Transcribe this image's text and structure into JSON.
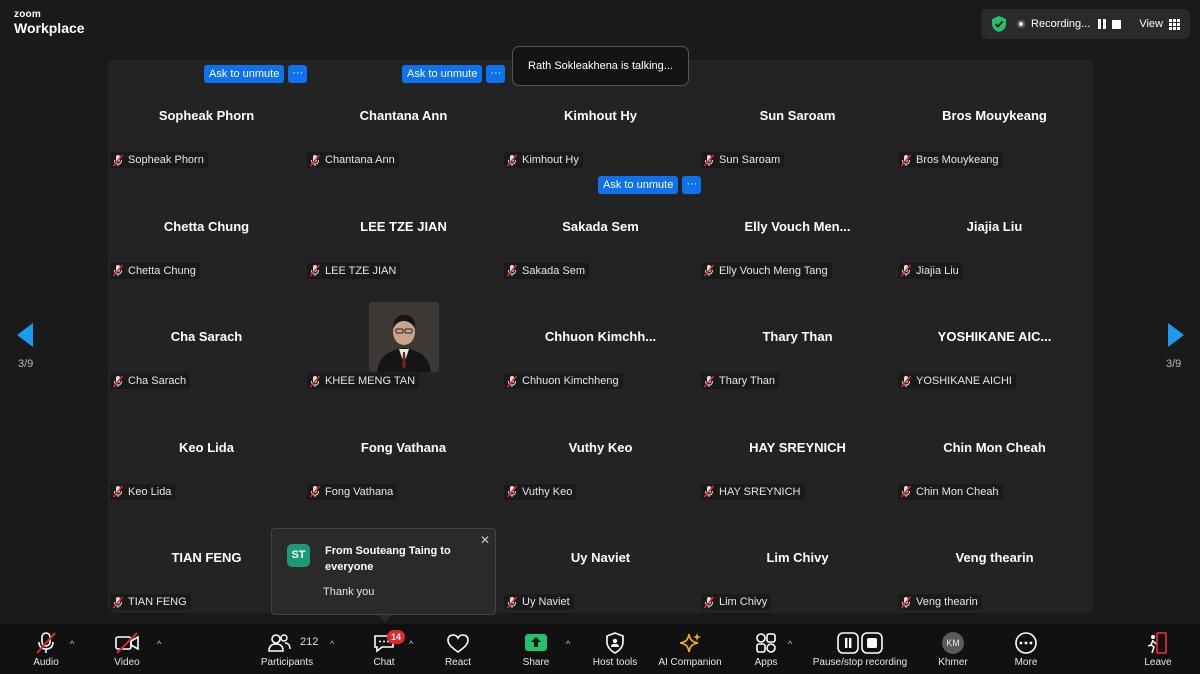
{
  "brand": {
    "line1": "zoom",
    "line2": "Workplace"
  },
  "status": {
    "recording_label": "Recording...",
    "view_label": "View"
  },
  "talking": "Rath Sokleakhena is talking...",
  "ask_unmute": {
    "label": "Ask to unmute",
    "more": "···"
  },
  "participants": [
    {
      "display": "Sopheak Phorn",
      "tag": "Sopheak Phorn"
    },
    {
      "display": "Chantana Ann",
      "tag": "Chantana Ann"
    },
    {
      "display": "Kimhout Hy",
      "tag": "Kimhout Hy"
    },
    {
      "display": "Sun Saroam",
      "tag": "Sun Saroam"
    },
    {
      "display": "Bros Mouykeang",
      "tag": "Bros Mouykeang"
    },
    {
      "display": "Chetta Chung",
      "tag": "Chetta Chung"
    },
    {
      "display": "LEE TZE JIAN",
      "tag": "LEE TZE JIAN"
    },
    {
      "display": "Sakada Sem",
      "tag": "Sakada Sem"
    },
    {
      "display": "Elly  Vouch  Men...",
      "tag": "Elly Vouch Meng Tang"
    },
    {
      "display": "Jiajia Liu",
      "tag": "Jiajia Liu"
    },
    {
      "display": "Cha Sarach",
      "tag": "Cha Sarach"
    },
    {
      "display": "",
      "tag": "KHEE MENG TAN"
    },
    {
      "display": "Chhuon  Kimchh...",
      "tag": "Chhuon Kimchheng"
    },
    {
      "display": "Thary Than",
      "tag": "Thary Than"
    },
    {
      "display": "YOSHIKANE  AIC...",
      "tag": "YOSHIKANE AICHI"
    },
    {
      "display": "Keo Lida",
      "tag": "Keo Lida"
    },
    {
      "display": "Fong Vathana",
      "tag": "Fong Vathana"
    },
    {
      "display": "Vuthy Keo",
      "tag": "Vuthy Keo"
    },
    {
      "display": "HAY SREYNICH",
      "tag": "HAY SREYNICH"
    },
    {
      "display": "Chin Mon Cheah",
      "tag": "Chin Mon Cheah"
    },
    {
      "display": "TIAN FENG",
      "tag": "TIAN FENG"
    },
    {
      "display": "",
      "tag": ""
    },
    {
      "display": "Uy Naviet",
      "tag": "Uy Naviet"
    },
    {
      "display": "Lim Chivy",
      "tag": "Lim Chivy"
    },
    {
      "display": "Veng thearin",
      "tag": "Veng thearin"
    }
  ],
  "pagination": {
    "left": "3/9",
    "right": "3/9"
  },
  "chat_popup": {
    "avatar": "ST",
    "from": "From Souteang Taing to everyone",
    "message": "Thank you",
    "close": "✕"
  },
  "toolbar": {
    "audio": "Audio",
    "video": "Video",
    "participants": "Participants",
    "participants_count": "212",
    "chat": "Chat",
    "chat_badge": "14",
    "react": "React",
    "share": "Share",
    "host_tools": "Host tools",
    "ai_companion": "AI Companion",
    "apps": "Apps",
    "pause_stop": "Pause/stop recording",
    "khmer_avatar": "KM",
    "khmer": "Khmer",
    "more": "More",
    "leave": "Leave"
  }
}
